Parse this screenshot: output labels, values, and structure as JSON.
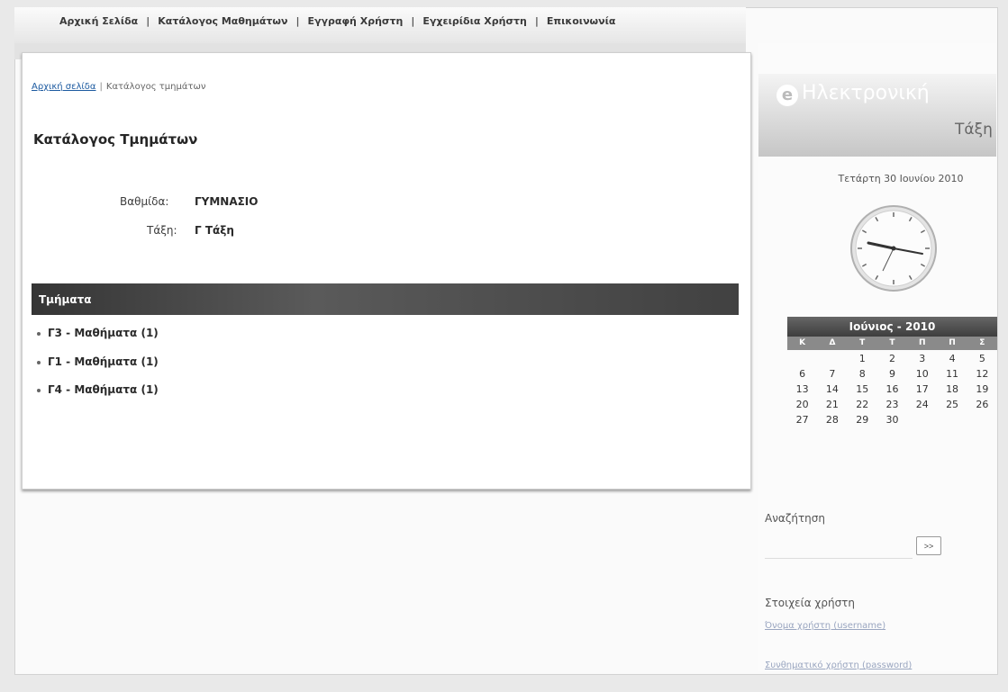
{
  "nav": {
    "items": [
      "Αρχική Σελίδα",
      "Κατάλογος Μαθημάτων",
      "Εγγραφή Χρήστη",
      "Εγχειρίδια Χρήστη",
      "Επικοινωνία"
    ],
    "separator": "|"
  },
  "breadcrumb": {
    "home": "Αρχική σελίδα",
    "separator": "|",
    "current": "Κατάλογος τμημάτων"
  },
  "page": {
    "title": "Κατάλογος Τμημάτων",
    "level_label": "Βαθμίδα:",
    "level_value": "ΓΥΜΝΑΣΙΟ",
    "class_label": "Τάξη:",
    "class_value": "Γ Τάξη"
  },
  "sections": {
    "header": "Τμήματα",
    "items": [
      "Γ3 - Μαθήματα (1)",
      "Γ1 - Μαθήματα (1)",
      "Γ4 - Μαθήματα (1)"
    ]
  },
  "sidebar": {
    "logo_line1": "Ηλεκτρονική",
    "logo_line2": "Τάξη",
    "date": "Τετάρτη 30 Ιουνίου 2010",
    "calendar": {
      "title": "Ιούνιος - 2010",
      "weekdays": [
        "Κ",
        "Δ",
        "Τ",
        "Τ",
        "Π",
        "Π",
        "Σ"
      ],
      "days": [
        "",
        "",
        "1",
        "2",
        "3",
        "4",
        "5",
        "6",
        "7",
        "8",
        "9",
        "10",
        "11",
        "12",
        "13",
        "14",
        "15",
        "16",
        "17",
        "18",
        "19",
        "20",
        "21",
        "22",
        "23",
        "24",
        "25",
        "26",
        "27",
        "28",
        "29",
        "30"
      ]
    },
    "search_label": "Αναζήτηση",
    "search_button": ">>",
    "user_section": "Στοιχεία χρήστη",
    "username_link": "Όνομα χρήστη (username)",
    "password_link": "Συνθηματικό χρήστη (password)"
  },
  "colors": {
    "section_header": "#3d3d3d",
    "link_blue": "#1c5aa0",
    "accent_gray": "#5a5a5a"
  }
}
